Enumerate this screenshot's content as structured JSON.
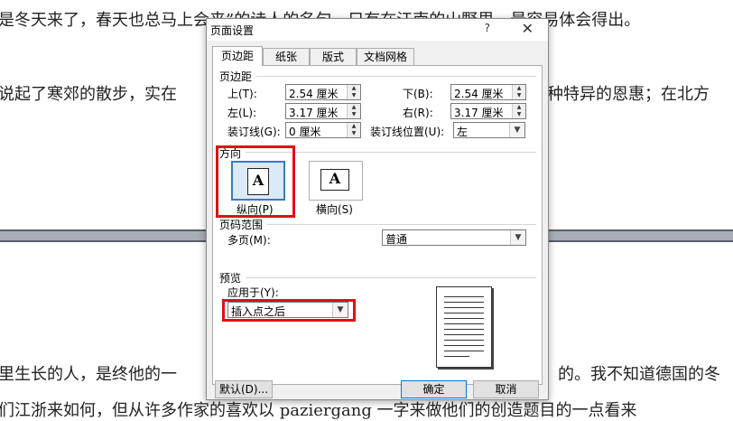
{
  "document": {
    "lines": [
      "是冬天来了，春天也总马上会来”的诗人的名句，只有在江南的山野里，最容易体会得出。",
      "说起了寒郊的散步，实在",
      "种特异的恩惠；在北方",
      "里生长的人，是终他的一",
      "的。我不知道德国的冬",
      "们江浙来如何，但从许多作家的喜欢以 paziergang 一字来做他们的创造题目的一点看来"
    ]
  },
  "dialog": {
    "title": "页面设置",
    "help_label": "?",
    "close_label": "✕",
    "tabs": [
      "页边距",
      "纸张",
      "版式",
      "文档网格"
    ],
    "margins": {
      "group_label": "页边距",
      "top_label": "上(T):",
      "top_value": "2.54 厘米",
      "bottom_label": "下(B):",
      "bottom_value": "2.54 厘米",
      "left_label": "左(L):",
      "left_value": "3.17 厘米",
      "right_label": "右(R):",
      "right_value": "3.17 厘米",
      "gutter_label": "装订线(G):",
      "gutter_value": "0 厘米",
      "gutter_pos_label": "装订线位置(U):",
      "gutter_pos_value": "左"
    },
    "orientation": {
      "group_label": "方向",
      "portrait_label": "纵向(P)",
      "landscape_label": "横向(S)",
      "glyph": "A"
    },
    "pages": {
      "group_label": "页码范围",
      "multiple_label": "多页(M):",
      "multiple_value": "普通"
    },
    "preview": {
      "group_label": "预览",
      "apply_to_label": "应用于(Y):",
      "apply_to_value": "插入点之后"
    },
    "buttons": {
      "default_label": "默认(D)...",
      "ok_label": "确定",
      "cancel_label": "取消"
    }
  }
}
